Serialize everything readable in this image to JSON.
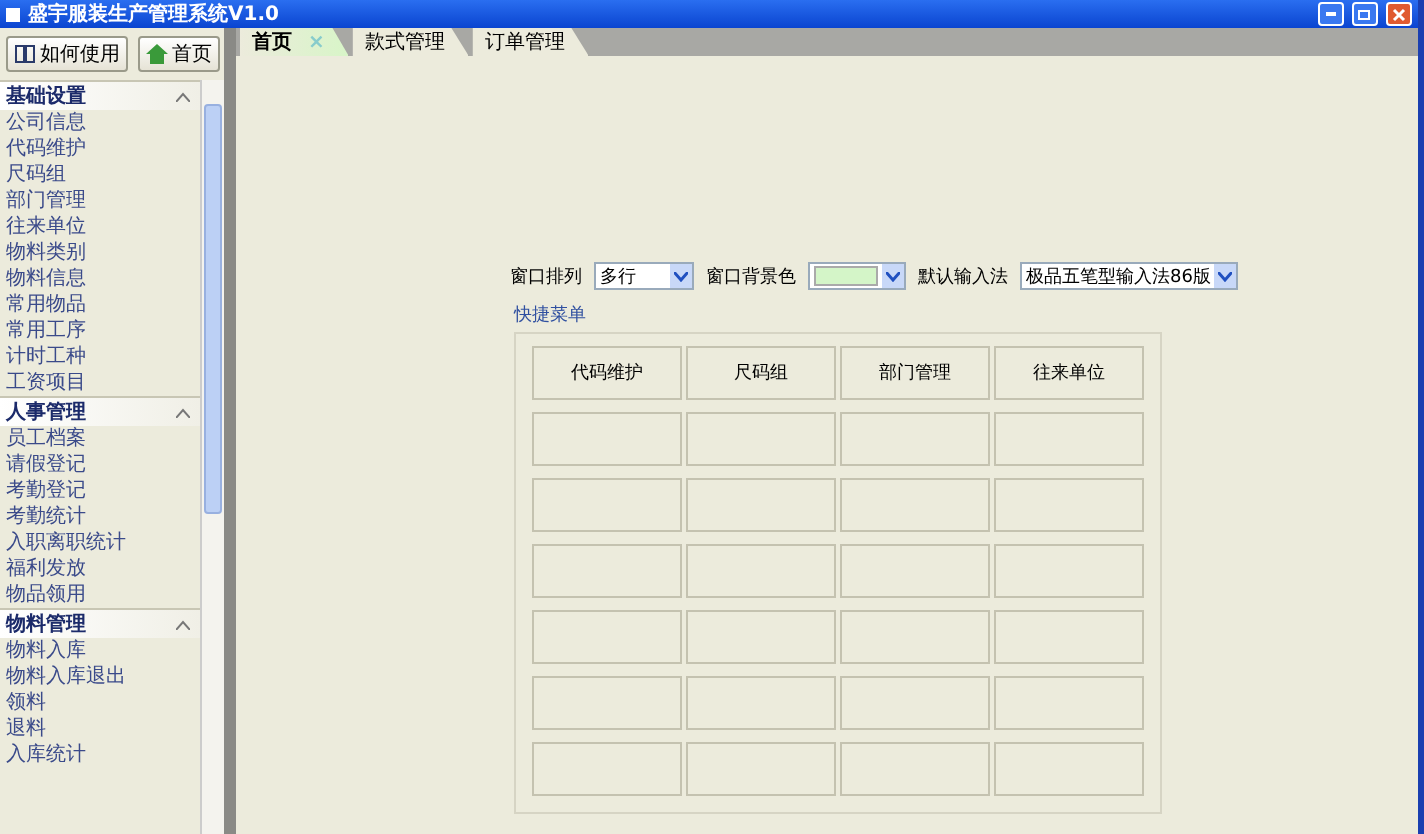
{
  "window": {
    "title": "盛宇服装生产管理系统V1.0"
  },
  "toolbar": [
    {
      "label": "如何使用",
      "kind": "help"
    },
    {
      "label": "首页",
      "kind": "home"
    }
  ],
  "sidebar": {
    "groups": [
      {
        "title": "基础设置",
        "expanded": true,
        "items": [
          "公司信息",
          "代码维护",
          "尺码组",
          "部门管理",
          "往来单位",
          "物料类别",
          "物料信息",
          "常用物品",
          "常用工序",
          "计时工种",
          "工资项目"
        ]
      },
      {
        "title": "人事管理",
        "expanded": true,
        "items": [
          "员工档案",
          "请假登记",
          "考勤登记",
          "考勤统计",
          "入职离职统计",
          "福利发放",
          "物品领用"
        ]
      },
      {
        "title": "物料管理",
        "expanded": true,
        "items": [
          "物料入库",
          "物料入库退出",
          "领料",
          "退料",
          "入库统计"
        ]
      }
    ]
  },
  "tabs": [
    {
      "label": "首页",
      "selected": true,
      "close": "×"
    },
    {
      "label": "款式管理",
      "selected": false
    },
    {
      "label": "订单管理",
      "selected": false
    }
  ],
  "settings": [
    {
      "label": "窗口排列",
      "kind": "select",
      "value": "多行"
    },
    {
      "label": "窗口背景色",
      "kind": "color",
      "color": "#d4f5c8"
    },
    {
      "label": "默认输入法",
      "kind": "select",
      "value": "极品五笔型输入法86版"
    }
  ],
  "quick_menu": {
    "title": "快捷菜单",
    "buttons": [
      "代码维护",
      "尺码组",
      "部门管理",
      "往来单位"
    ]
  }
}
